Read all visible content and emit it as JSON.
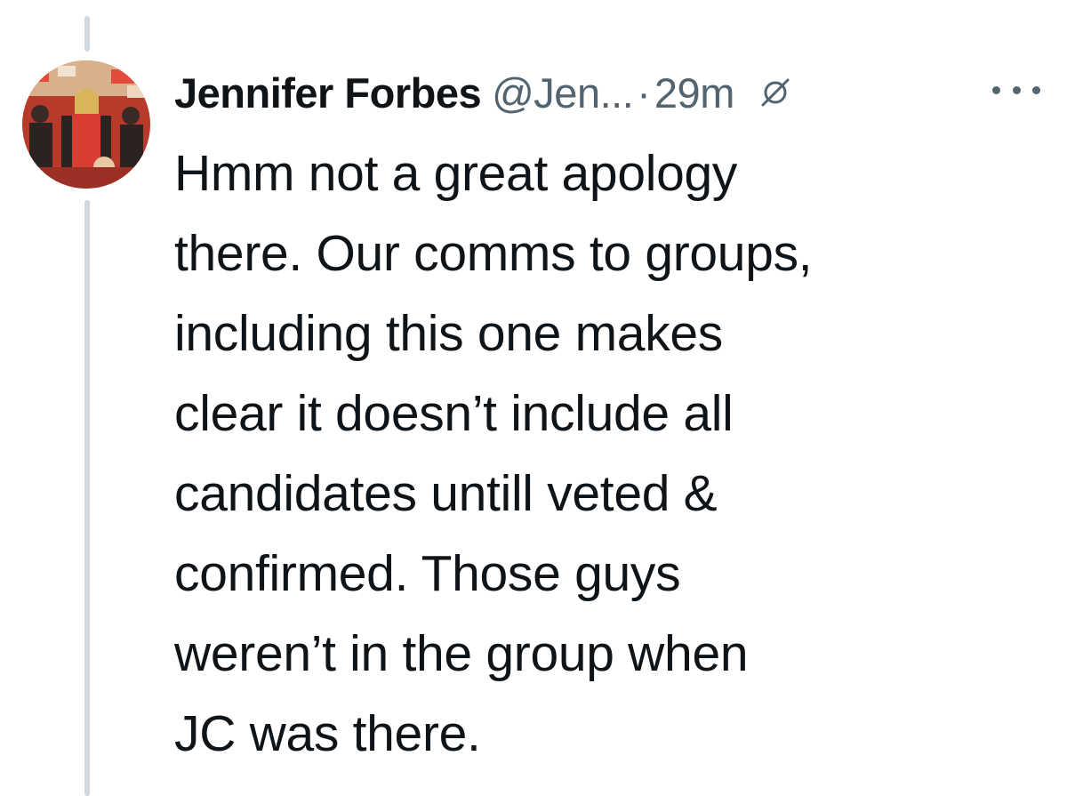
{
  "tweet": {
    "display_name": "Jennifer Forbes",
    "handle": "@Jen...",
    "separator": "·",
    "time": "29m",
    "body_lines": [
      "Hmm not a great apology",
      "there. Our comms to groups,",
      "including this one makes",
      "clear it doesn’t include all",
      "candidates untill veted &",
      "confirmed. Those guys",
      "weren’t in the group when",
      "JC was there."
    ]
  },
  "icons": {
    "edited": "edited-pencil-icon",
    "more": "more-options-icon"
  },
  "colors": {
    "text_primary": "#0f1419",
    "text_secondary": "#536471",
    "thread_line": "#cfd9de"
  }
}
